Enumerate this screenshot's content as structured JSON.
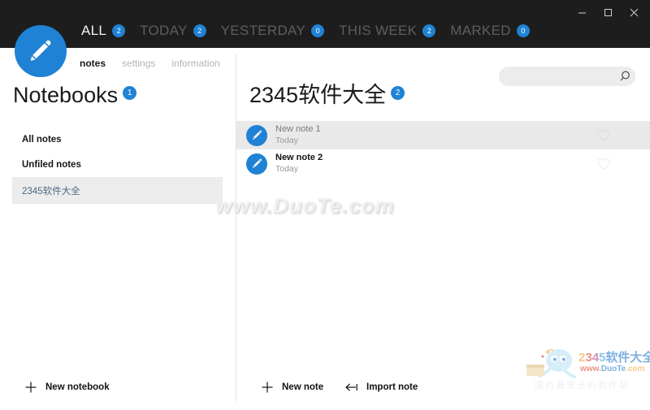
{
  "window": {
    "controls": [
      {
        "name": "minimize",
        "glyph": "minimize-icon"
      },
      {
        "name": "maximize",
        "glyph": "maximize-icon"
      },
      {
        "name": "close",
        "glyph": "close-icon"
      }
    ]
  },
  "brand": {
    "logo_icon": "pencil-icon",
    "accent_color": "#1f82d4",
    "titlebar_color": "#1d1d1d"
  },
  "navtabs": [
    {
      "label": "ALL",
      "count": "2",
      "active": true
    },
    {
      "label": "TODAY",
      "count": "2",
      "active": false
    },
    {
      "label": "YESTERDAY",
      "count": "0",
      "active": false
    },
    {
      "label": "THIS WEEK",
      "count": "2",
      "active": false
    },
    {
      "label": "MARKED",
      "count": "0",
      "active": false
    }
  ],
  "subnav": [
    {
      "label": "notes",
      "active": true
    },
    {
      "label": "settings",
      "active": false
    },
    {
      "label": "information",
      "active": false
    }
  ],
  "search": {
    "value": "",
    "placeholder": "",
    "icon": "search-icon"
  },
  "sidebar": {
    "title": "Notebooks",
    "count": "1",
    "items": [
      {
        "label": "All notes",
        "selected": false
      },
      {
        "label": "Unfiled notes",
        "selected": false
      },
      {
        "label": "2345软件大全",
        "selected": true
      }
    ],
    "footer": {
      "new_notebook_label": "New notebook",
      "new_notebook_icon": "plus-icon"
    }
  },
  "main": {
    "title": "2345软件大全",
    "count": "2",
    "notes": [
      {
        "title": "New note 1",
        "date": "Today",
        "icon": "pencil-icon",
        "favorite_icon": "heart-icon",
        "selected": true
      },
      {
        "title": "New note 2",
        "date": "Today",
        "icon": "pencil-icon",
        "favorite_icon": "heart-icon",
        "selected": false
      }
    ],
    "footer": {
      "new_note_label": "New note",
      "new_note_icon": "plus-icon",
      "import_note_label": "Import note",
      "import_note_icon": "import-arrow-icon"
    }
  },
  "watermarks": {
    "center": "www.DuoTe.com",
    "logo": {
      "digits": [
        "2",
        "3",
        "4",
        "5"
      ],
      "name": "软件大全",
      "url": "www.DuoTe.com",
      "tagline": "国内最安全的软件站"
    }
  }
}
